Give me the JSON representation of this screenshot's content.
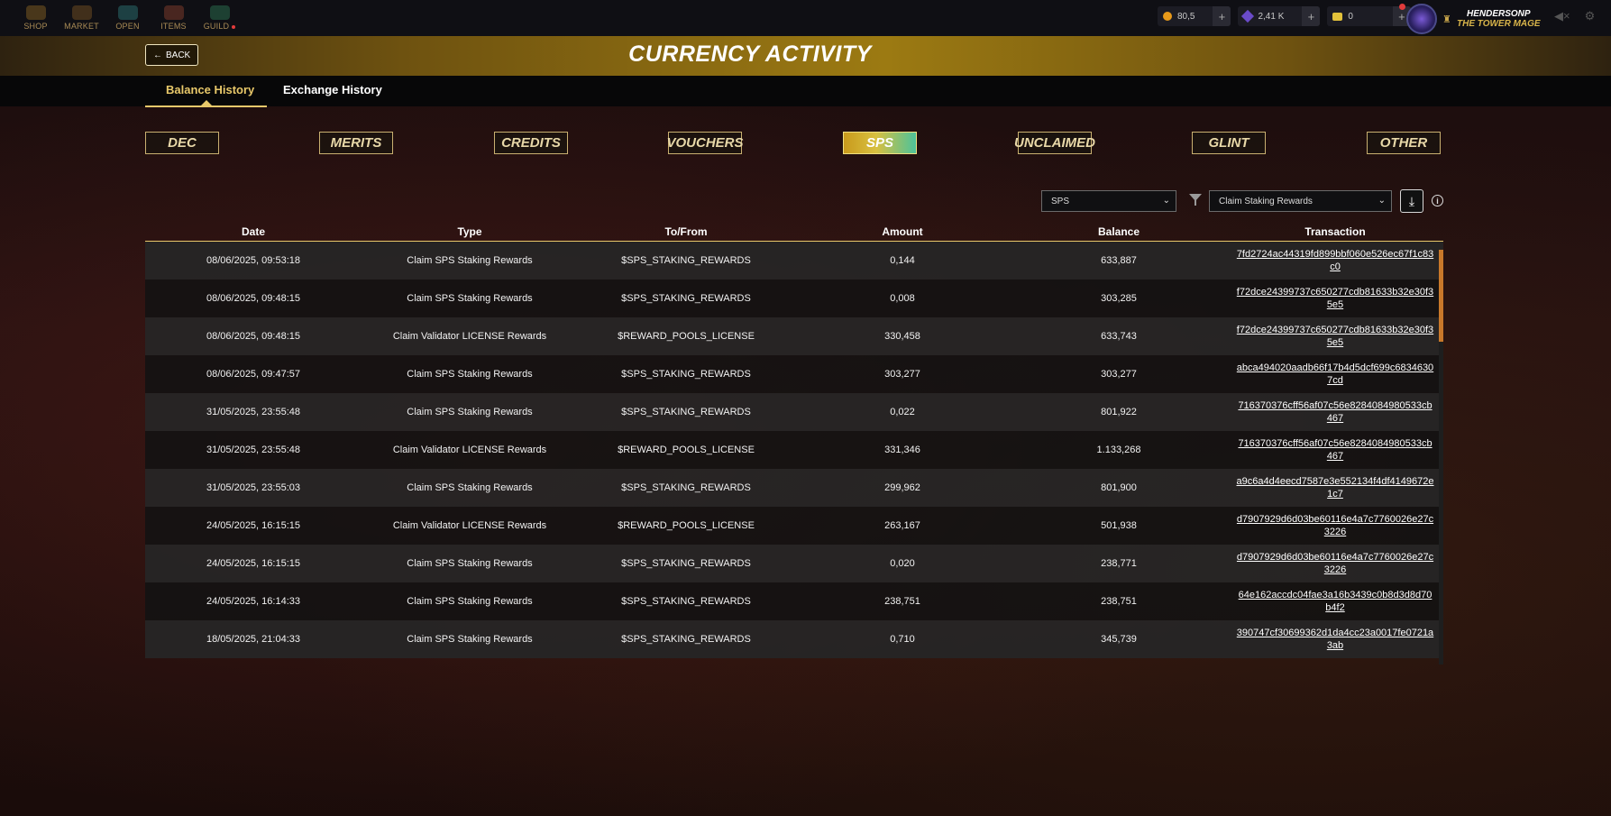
{
  "nav": {
    "items": [
      {
        "label": "SHOP",
        "icon": "shop-icon"
      },
      {
        "label": "MARKET",
        "icon": "market-icon"
      },
      {
        "label": "OPEN",
        "icon": "open-pack-icon"
      },
      {
        "label": "ITEMS",
        "icon": "items-icon"
      },
      {
        "label": "GUILD",
        "icon": "guild-icon"
      }
    ]
  },
  "wallet": {
    "credits": "80,5",
    "dec": "2,41 K",
    "tickets": "0"
  },
  "user": {
    "name": "HENDERSONP",
    "title": "THE TOWER MAGE"
  },
  "header": {
    "back_label": "BACK",
    "title": "CURRENCY ACTIVITY"
  },
  "tabs": [
    {
      "label": "Balance History",
      "active": true
    },
    {
      "label": "Exchange History",
      "active": false
    }
  ],
  "currency_buttons": [
    "DEC",
    "MERITS",
    "CREDITS",
    "VOUCHERS",
    "SPS",
    "UNCLAIMED",
    "GLINT",
    "OTHER"
  ],
  "currency_active": "SPS",
  "filters": {
    "token_select": "SPS",
    "type_select": "Claim Staking Rewards"
  },
  "table": {
    "headers": [
      "Date",
      "Type",
      "To/From",
      "Amount",
      "Balance",
      "Transaction"
    ],
    "rows": [
      [
        "08/06/2025, 09:53:18",
        "Claim SPS Staking Rewards",
        "$SPS_STAKING_REWARDS",
        "0,144",
        "633,887",
        "7fd2724ac44319fd899bbf060e526ec67f1c83c0"
      ],
      [
        "08/06/2025, 09:48:15",
        "Claim SPS Staking Rewards",
        "$SPS_STAKING_REWARDS",
        "0,008",
        "303,285",
        "f72dce24399737c650277cdb81633b32e30f35e5"
      ],
      [
        "08/06/2025, 09:48:15",
        "Claim Validator LICENSE Rewards",
        "$REWARD_POOLS_LICENSE",
        "330,458",
        "633,743",
        "f72dce24399737c650277cdb81633b32e30f35e5"
      ],
      [
        "08/06/2025, 09:47:57",
        "Claim SPS Staking Rewards",
        "$SPS_STAKING_REWARDS",
        "303,277",
        "303,277",
        "abca494020aadb66f17b4d5dcf699c68346307cd"
      ],
      [
        "31/05/2025, 23:55:48",
        "Claim SPS Staking Rewards",
        "$SPS_STAKING_REWARDS",
        "0,022",
        "801,922",
        "716370376cff56af07c56e8284084980533cb467"
      ],
      [
        "31/05/2025, 23:55:48",
        "Claim Validator LICENSE Rewards",
        "$REWARD_POOLS_LICENSE",
        "331,346",
        "1.133,268",
        "716370376cff56af07c56e8284084980533cb467"
      ],
      [
        "31/05/2025, 23:55:03",
        "Claim SPS Staking Rewards",
        "$SPS_STAKING_REWARDS",
        "299,962",
        "801,900",
        "a9c6a4d4eecd7587e3e552134f4df4149672e1c7"
      ],
      [
        "24/05/2025, 16:15:15",
        "Claim Validator LICENSE Rewards",
        "$REWARD_POOLS_LICENSE",
        "263,167",
        "501,938",
        "d7907929d6d03be60116e4a7c7760026e27c3226"
      ],
      [
        "24/05/2025, 16:15:15",
        "Claim SPS Staking Rewards",
        "$SPS_STAKING_REWARDS",
        "0,020",
        "238,771",
        "d7907929d6d03be60116e4a7c7760026e27c3226"
      ],
      [
        "24/05/2025, 16:14:33",
        "Claim SPS Staking Rewards",
        "$SPS_STAKING_REWARDS",
        "238,751",
        "238,751",
        "64e162accdc04fae3a16b3439c0b8d3d8d70b4f2"
      ],
      [
        "18/05/2025, 21:04:33",
        "Claim SPS Staking Rewards",
        "$SPS_STAKING_REWARDS",
        "0,710",
        "345,739",
        "390747cf30699362d1da4cc23a0017fe0721a3ab"
      ]
    ]
  },
  "colors": {
    "accent_gold": "#e8c86a",
    "sps_gradient_start": "#c99a1c",
    "sps_gradient_end": "#4dc29a",
    "scrollbar": "#c8782a"
  }
}
